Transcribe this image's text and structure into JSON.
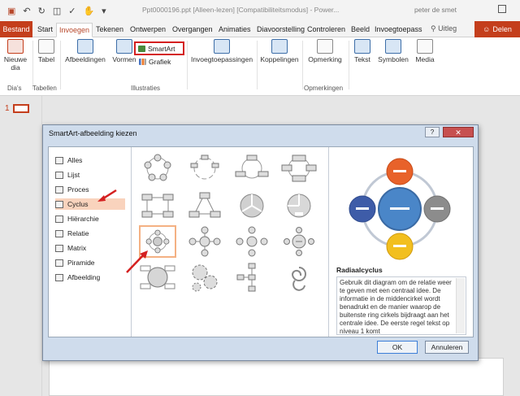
{
  "window": {
    "title": "Ppt0000196.ppt [Alleen-lezen] [Compatibiliteitsmodus] - Power...",
    "user": "peter de smet"
  },
  "tabs": {
    "file": "Bestand",
    "items": [
      "Start",
      "Invoegen",
      "Tekenen",
      "Ontwerpen",
      "Overgangen",
      "Animaties",
      "Diavoorstelling",
      "Controleren",
      "Beeld",
      "Invoegtoepass"
    ],
    "active": "Invoegen",
    "tell": "Uitleg",
    "share": "Delen"
  },
  "ribbon": {
    "new_slide_label": "Nieuwe dia",
    "group_slides": "Dia's",
    "table_label": "Tabel",
    "group_tables": "Tabellen",
    "images_label": "Afbeeldingen",
    "shapes_label": "Vormen",
    "smartart_label": "SmartArt",
    "chart_label": "Grafiek",
    "group_illustrations": "Illustraties",
    "addins_label": "Invoegtoepassingen",
    "links_label": "Koppelingen",
    "comment_label": "Opmerking",
    "group_comments": "Opmerkingen",
    "text_label": "Tekst",
    "symbols_label": "Symbolen",
    "media_label": "Media"
  },
  "thumbs": {
    "slide_number": "1"
  },
  "dialog": {
    "title": "SmartArt-afbeelding kiezen",
    "help": "?",
    "close": "✕",
    "categories": [
      "Alles",
      "Lijst",
      "Proces",
      "Cyclus",
      "Hiërarchie",
      "Relatie",
      "Matrix",
      "Piramide",
      "Afbeelding"
    ],
    "selected_category": "Cyclus",
    "preview_title": "Radiaalcyclus",
    "preview_text": "Gebruik dit diagram om de relatie weer te geven met een centraal idee. De informatie in de middencirkel wordt benadrukt en de manier waarop de buitenste ring cirkels bijdraagt aan het centrale idee. De eerste regel tekst op niveau 1 komt",
    "ok": "OK",
    "cancel": "Annuleren"
  },
  "colors": {
    "accent": "#c43e1c",
    "preview_center": "#4a86c8",
    "preview_top": "#e8622a",
    "preview_right": "#8c8c8c",
    "preview_bottom": "#f2bf1f",
    "preview_left": "#3e5ca8",
    "annotation_red": "#d42020"
  }
}
